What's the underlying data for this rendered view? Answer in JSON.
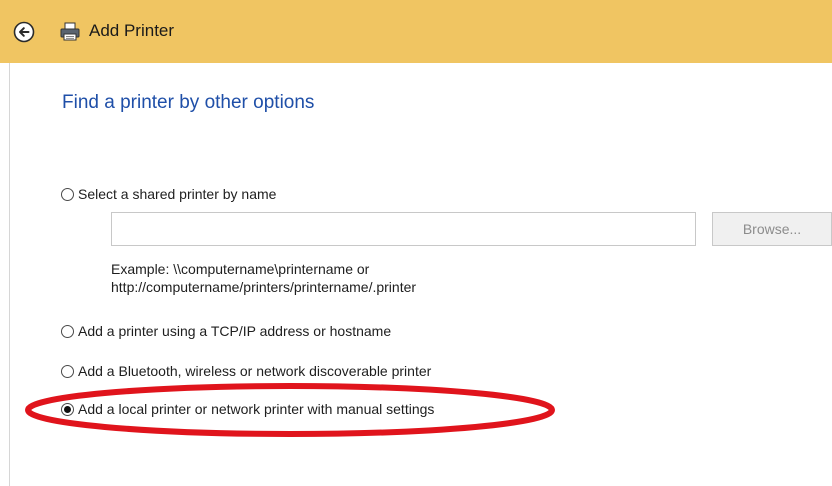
{
  "titlebar": {
    "title": "Add Printer",
    "back_icon": "back-arrow-icon",
    "app_icon": "printer-icon",
    "background_color": "#f0c562"
  },
  "heading": "Find a printer by other options",
  "heading_color": "#1f4fa8",
  "options": [
    {
      "label": "Select a shared printer by name",
      "checked": false
    },
    {
      "label": "Add a printer using a TCP/IP address or hostname",
      "checked": false
    },
    {
      "label": "Add a Bluetooth, wireless or network discoverable printer",
      "checked": false
    },
    {
      "label": "Add a local printer or network printer with manual settings",
      "checked": true
    }
  ],
  "shared_printer": {
    "input_value": "",
    "browse_label": "Browse...",
    "example_line1": "Example: \\\\computername\\printername or",
    "example_line2": "http://computername/printers/printername/.printer"
  },
  "annotation": {
    "color": "#e0141c"
  }
}
